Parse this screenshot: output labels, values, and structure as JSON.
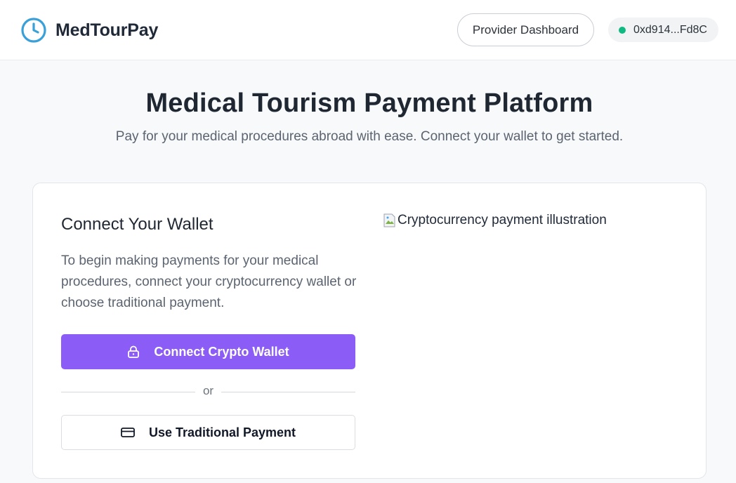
{
  "header": {
    "brand": "MedTourPay",
    "logo_icon": "clock-icon",
    "provider_dashboard_label": "Provider Dashboard",
    "wallet_address": "0xd914...Fd8C",
    "wallet_status_color": "#10b981"
  },
  "hero": {
    "title": "Medical Tourism Payment Platform",
    "subtitle": "Pay for your medical procedures abroad with ease. Connect your wallet to get started."
  },
  "wallet_card": {
    "title": "Connect Your Wallet",
    "description": "To begin making payments for your medical procedures, connect your cryptocurrency wallet or choose traditional payment.",
    "connect_button_label": "Connect Crypto Wallet",
    "connect_button_icon": "lock-icon",
    "divider_text": "or",
    "traditional_button_label": "Use Traditional Payment",
    "traditional_button_icon": "credit-card-icon",
    "image_alt": "Cryptocurrency payment illustration"
  },
  "colors": {
    "accent": "#8b5cf6",
    "logo": "#3aa0d8",
    "status": "#10b981"
  }
}
